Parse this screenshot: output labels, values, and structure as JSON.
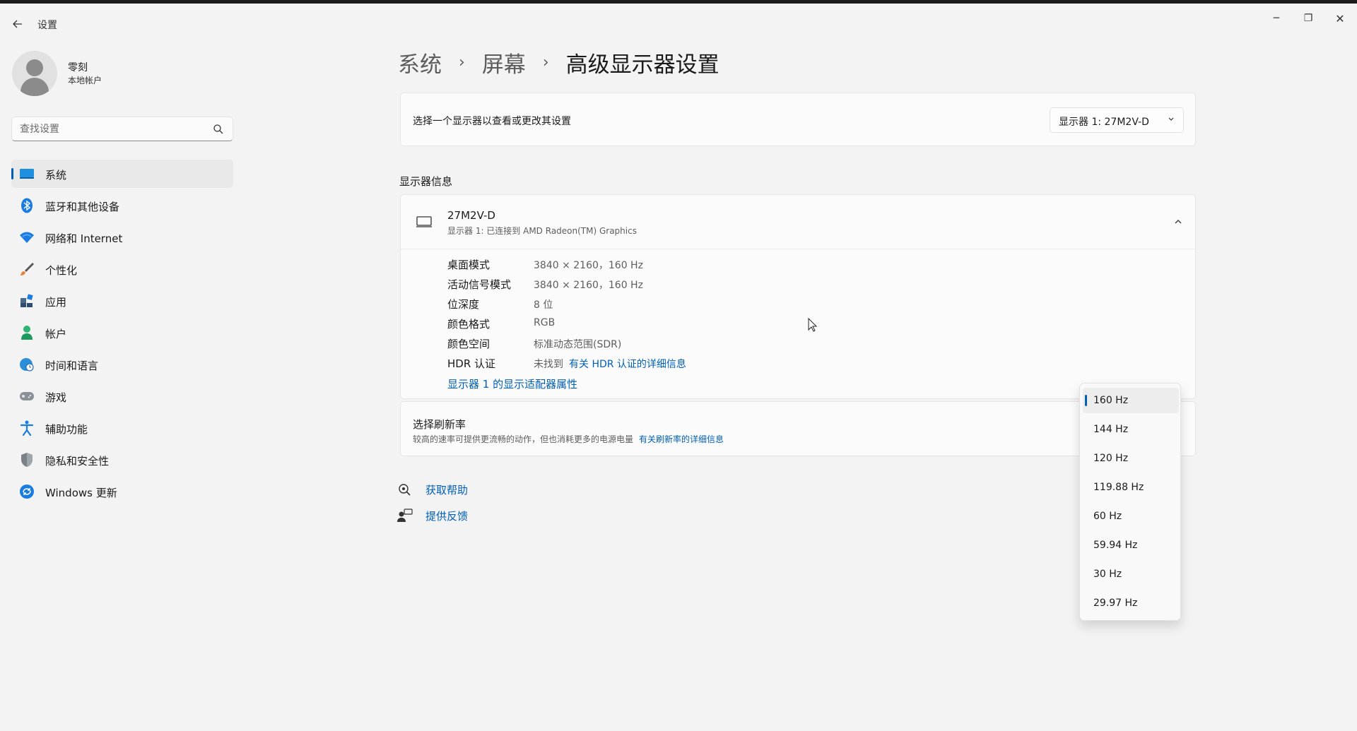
{
  "window": {
    "title": "设置",
    "controls": {
      "minimize": "─",
      "maximize": "❐",
      "close": "✕"
    }
  },
  "user": {
    "name": "零刻",
    "account_type": "本地帐户"
  },
  "search": {
    "placeholder": "查找设置"
  },
  "sidebar": {
    "items": [
      {
        "label": "系统",
        "icon": "system-icon",
        "active": true
      },
      {
        "label": "蓝牙和其他设备",
        "icon": "bluetooth-icon"
      },
      {
        "label": "网络和 Internet",
        "icon": "wifi-icon"
      },
      {
        "label": "个性化",
        "icon": "brush-icon"
      },
      {
        "label": "应用",
        "icon": "apps-icon"
      },
      {
        "label": "帐户",
        "icon": "person-icon"
      },
      {
        "label": "时间和语言",
        "icon": "globe-clock-icon"
      },
      {
        "label": "游戏",
        "icon": "gamepad-icon"
      },
      {
        "label": "辅助功能",
        "icon": "accessibility-icon"
      },
      {
        "label": "隐私和安全性",
        "icon": "shield-icon"
      },
      {
        "label": "Windows 更新",
        "icon": "update-icon"
      }
    ]
  },
  "breadcrumb": {
    "items": [
      "系统",
      "屏幕"
    ],
    "current": "高级显示器设置",
    "separator": "›"
  },
  "display_select": {
    "label": "选择一个显示器以查看或更改其设置",
    "value": "显示器 1: 27M2V-D"
  },
  "display_info": {
    "section_title": "显示器信息",
    "monitor_name": "27M2V-D",
    "monitor_desc": "显示器 1: 已连接到 AMD Radeon(TM) Graphics",
    "specs": {
      "desktop_mode": {
        "label": "桌面模式",
        "value": "3840 × 2160，160 Hz"
      },
      "active_signal": {
        "label": "活动信号模式",
        "value": "3840 × 2160，160 Hz"
      },
      "bit_depth": {
        "label": "位深度",
        "value": "8 位"
      },
      "color_format": {
        "label": "颜色格式",
        "value": "RGB"
      },
      "color_space": {
        "label": "颜色空间",
        "value": "标准动态范围(SDR)"
      },
      "hdr": {
        "label": "HDR 认证",
        "value": "未找到",
        "link": "有关 HDR 认证的详细信息"
      }
    },
    "adapter_link": "显示器 1 的显示适配器属性"
  },
  "refresh": {
    "title": "选择刷新率",
    "desc": "较高的速率可提供更流畅的动作，但也消耗更多的电源电量",
    "link": "有关刷新率的详细信息"
  },
  "help": {
    "get_help": "获取帮助",
    "feedback": "提供反馈"
  },
  "refresh_menu": {
    "selected": "160 Hz",
    "options": [
      "160 Hz",
      "144 Hz",
      "120 Hz",
      "119.88 Hz",
      "60 Hz",
      "59.94 Hz",
      "30 Hz",
      "29.97 Hz"
    ]
  },
  "colors": {
    "accent": "#005fb8",
    "background": "#f3f3f3",
    "card": "#fbfbfb"
  }
}
